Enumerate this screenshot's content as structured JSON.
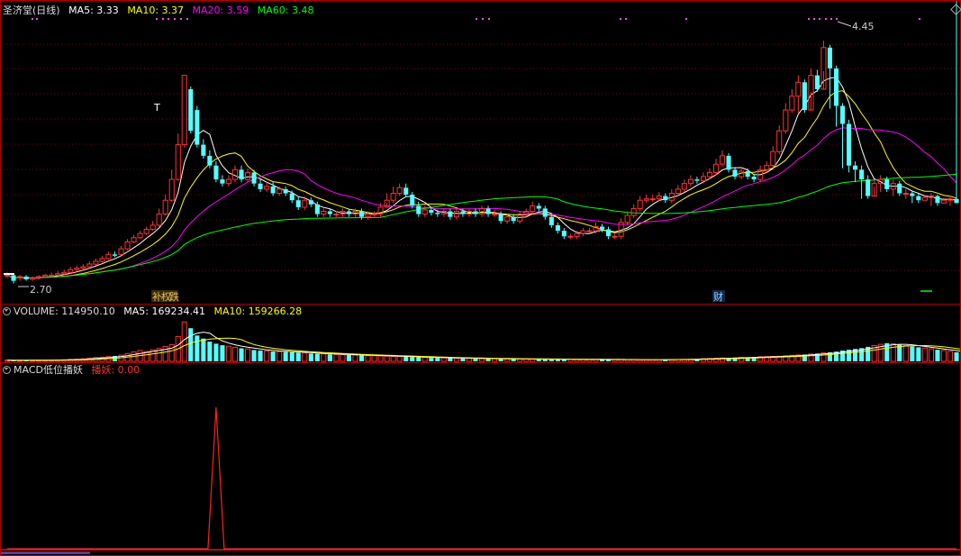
{
  "header": {
    "stock": "圣济堂(日线)",
    "ma5": "MA5: 3.33",
    "ma10": "MA10: 3.37",
    "ma20": "MA20: 3.59",
    "ma60": "MA60: 3.48"
  },
  "volume_header": {
    "title": "VOLUME: 114950.10",
    "ma5": "MA5: 169234.41",
    "ma10": "MA10: 159266.28"
  },
  "macd_header": {
    "title": "MACD低位播妖",
    "value": "播妖: 0.00"
  },
  "annotations": {
    "high": "4.45",
    "low": "2.70",
    "t_mark": "T",
    "event1": "补",
    "event2": "权",
    "event3": "跌",
    "event4": "财"
  },
  "colors": {
    "up": "#ff3232",
    "down": "#54ffff",
    "ma5": "#ffffff",
    "ma10": "#ffff00",
    "ma20": "#ff00ff",
    "ma60": "#00ff00",
    "grid": "#7a0000",
    "frame": "#b00000",
    "macd": "#ff2020"
  },
  "chart_data": [
    {
      "type": "candlestick",
      "title": "圣济堂(日线)",
      "ylim": [
        2.6,
        4.6
      ],
      "x": [
        0,
        1,
        2,
        3,
        4,
        5,
        6,
        7,
        8,
        9,
        10,
        11,
        12,
        13,
        14,
        15,
        16,
        17,
        18,
        19,
        20,
        21,
        22,
        23,
        24,
        25,
        26,
        27,
        28,
        29,
        30,
        31,
        32,
        33,
        34,
        35,
        36,
        37,
        38,
        39,
        40,
        41,
        42,
        43,
        44,
        45,
        46,
        47,
        48,
        49,
        50,
        51,
        52,
        53,
        54,
        55,
        56,
        57,
        58,
        59,
        60,
        61,
        62,
        63,
        64,
        65,
        66,
        67,
        68,
        69,
        70,
        71,
        72,
        73,
        74,
        75,
        76,
        77,
        78,
        79,
        80,
        81,
        82,
        83,
        84,
        85,
        86,
        87,
        88,
        89,
        90,
        91,
        92,
        93,
        94,
        95,
        96,
        97,
        98,
        99,
        100,
        101,
        102,
        103,
        104,
        105,
        106,
        107,
        108,
        109,
        110,
        111,
        112,
        113,
        114,
        115,
        116,
        117,
        118,
        119,
        120,
        121,
        122,
        123,
        124,
        125,
        126,
        127,
        128,
        129,
        130,
        131,
        132,
        133,
        134,
        135,
        136,
        137,
        138,
        139,
        140,
        141,
        142,
        143,
        144,
        145,
        146,
        147,
        148,
        149,
        150,
        151,
        152,
        153,
        154,
        155,
        156,
        157,
        158,
        159,
        160,
        161,
        162,
        163,
        164,
        165,
        166,
        167,
        168,
        169,
        170,
        171,
        172,
        173,
        174,
        175,
        176,
        177
      ],
      "open": [
        2.76,
        2.76,
        2.74,
        2.75,
        2.73,
        2.74,
        2.75,
        2.76,
        2.76,
        2.77,
        2.78,
        2.8,
        2.81,
        2.82,
        2.84,
        2.86,
        2.88,
        2.91,
        2.91,
        2.95,
        3.0,
        3.03,
        3.06,
        3.09,
        3.12,
        3.2,
        3.3,
        3.45,
        3.7,
        4.1,
        3.95,
        3.7,
        3.62,
        3.55,
        3.45,
        3.42,
        3.45,
        3.52,
        3.45,
        3.5,
        3.42,
        3.38,
        3.4,
        3.35,
        3.38,
        3.35,
        3.3,
        3.25,
        3.3,
        3.27,
        3.2,
        3.22,
        3.2,
        3.2,
        3.22,
        3.2,
        3.22,
        3.18,
        3.2,
        3.2,
        3.25,
        3.3,
        3.35,
        3.39,
        3.34,
        3.26,
        3.2,
        3.23,
        3.21,
        3.2,
        3.22,
        3.18,
        3.22,
        3.2,
        3.22,
        3.2,
        3.24,
        3.2,
        3.2,
        3.15,
        3.18,
        3.15,
        3.2,
        3.22,
        3.26,
        3.24,
        3.18,
        3.12,
        3.08,
        3.04,
        3.04,
        3.06,
        3.08,
        3.08,
        3.11,
        3.09,
        3.04,
        3.04,
        3.14,
        3.19,
        3.24,
        3.3,
        3.31,
        3.31,
        3.33,
        3.3,
        3.35,
        3.38,
        3.42,
        3.45,
        3.44,
        3.47,
        3.5,
        3.56,
        3.62,
        3.52,
        3.47,
        3.51,
        3.47,
        3.45,
        3.52,
        3.55,
        3.65,
        3.8,
        3.95,
        4.05,
        4.15,
        3.95,
        4.2,
        4.1,
        4.4,
        4.25,
        3.98,
        3.85,
        3.55,
        3.52,
        3.45,
        3.33,
        3.42,
        3.45,
        3.38,
        3.42,
        3.35,
        3.35,
        3.33,
        3.3,
        3.32,
        3.33,
        3.28,
        3.3,
        3.31
      ],
      "close": [
        2.76,
        2.72,
        2.75,
        2.73,
        2.74,
        2.75,
        2.76,
        2.76,
        2.77,
        2.78,
        2.8,
        2.81,
        2.82,
        2.84,
        2.86,
        2.88,
        2.91,
        2.9,
        2.95,
        3.0,
        3.03,
        3.06,
        3.09,
        3.12,
        3.2,
        3.3,
        3.45,
        3.7,
        4.2,
        3.8,
        3.7,
        3.62,
        3.55,
        3.45,
        3.42,
        3.45,
        3.52,
        3.45,
        3.5,
        3.42,
        3.38,
        3.4,
        3.35,
        3.38,
        3.35,
        3.3,
        3.25,
        3.3,
        3.27,
        3.2,
        3.22,
        3.2,
        3.2,
        3.22,
        3.2,
        3.22,
        3.18,
        3.2,
        3.2,
        3.25,
        3.3,
        3.35,
        3.39,
        3.34,
        3.26,
        3.2,
        3.23,
        3.21,
        3.2,
        3.22,
        3.18,
        3.22,
        3.2,
        3.22,
        3.2,
        3.24,
        3.2,
        3.2,
        3.15,
        3.18,
        3.15,
        3.2,
        3.22,
        3.26,
        3.24,
        3.18,
        3.12,
        3.08,
        3.04,
        3.04,
        3.06,
        3.08,
        3.08,
        3.11,
        3.09,
        3.04,
        3.04,
        3.14,
        3.19,
        3.24,
        3.3,
        3.31,
        3.31,
        3.33,
        3.3,
        3.35,
        3.38,
        3.42,
        3.45,
        3.44,
        3.47,
        3.5,
        3.56,
        3.62,
        3.52,
        3.47,
        3.51,
        3.47,
        3.45,
        3.52,
        3.55,
        3.65,
        3.8,
        3.95,
        4.05,
        4.15,
        3.95,
        4.2,
        4.1,
        4.4,
        4.25,
        3.98,
        3.85,
        3.55,
        3.52,
        3.45,
        3.33,
        3.42,
        3.45,
        3.38,
        3.42,
        3.35,
        3.35,
        3.33,
        3.3,
        3.32,
        3.33,
        3.28,
        3.3,
        3.31,
        3.28
      ],
      "high": [
        2.78,
        2.77,
        2.76,
        2.76,
        2.75,
        2.76,
        2.77,
        2.78,
        2.79,
        2.8,
        2.82,
        2.83,
        2.84,
        2.86,
        2.88,
        2.9,
        2.93,
        2.93,
        2.97,
        3.02,
        3.05,
        3.08,
        3.11,
        3.15,
        3.24,
        3.34,
        3.52,
        3.78,
        4.2,
        4.12,
        3.98,
        3.74,
        3.66,
        3.58,
        3.48,
        3.48,
        3.55,
        3.55,
        3.53,
        3.52,
        3.45,
        3.43,
        3.43,
        3.4,
        3.4,
        3.37,
        3.33,
        3.33,
        3.32,
        3.29,
        3.24,
        3.24,
        3.22,
        3.24,
        3.24,
        3.24,
        3.24,
        3.22,
        3.22,
        3.28,
        3.35,
        3.4,
        3.42,
        3.42,
        3.36,
        3.29,
        3.26,
        3.25,
        3.23,
        3.24,
        3.24,
        3.24,
        3.24,
        3.24,
        3.24,
        3.26,
        3.26,
        3.23,
        3.22,
        3.2,
        3.2,
        3.22,
        3.24,
        3.29,
        3.28,
        3.26,
        3.2,
        3.14,
        3.1,
        3.06,
        3.08,
        3.1,
        3.1,
        3.14,
        3.13,
        3.11,
        3.06,
        3.17,
        3.22,
        3.27,
        3.33,
        3.34,
        3.34,
        3.36,
        3.35,
        3.38,
        3.41,
        3.45,
        3.48,
        3.47,
        3.5,
        3.53,
        3.6,
        3.66,
        3.64,
        3.54,
        3.54,
        3.53,
        3.49,
        3.55,
        3.58,
        3.69,
        3.84,
        4.0,
        4.1,
        4.2,
        4.17,
        4.25,
        4.24,
        4.45,
        4.42,
        4.27,
        4.0,
        3.88,
        3.58,
        3.55,
        3.48,
        3.45,
        3.48,
        3.47,
        3.45,
        3.44,
        3.38,
        3.37,
        3.35,
        3.34,
        3.35,
        3.34,
        3.32,
        3.33,
        3.33
      ],
      "low": [
        2.74,
        2.7,
        2.72,
        2.72,
        2.72,
        2.73,
        2.74,
        2.75,
        2.75,
        2.76,
        2.77,
        2.79,
        2.8,
        2.81,
        2.83,
        2.85,
        2.87,
        2.89,
        2.9,
        2.94,
        2.99,
        3.02,
        3.05,
        3.08,
        3.11,
        3.19,
        3.29,
        3.44,
        3.68,
        3.78,
        3.68,
        3.6,
        3.53,
        3.43,
        3.4,
        3.4,
        3.43,
        3.43,
        3.43,
        3.4,
        3.36,
        3.36,
        3.33,
        3.33,
        3.33,
        3.28,
        3.23,
        3.23,
        3.25,
        3.18,
        3.18,
        3.18,
        3.18,
        3.18,
        3.18,
        3.18,
        3.16,
        3.16,
        3.18,
        3.18,
        3.28,
        3.28,
        3.33,
        3.32,
        3.24,
        3.18,
        3.18,
        3.19,
        3.18,
        3.18,
        3.16,
        3.16,
        3.18,
        3.18,
        3.18,
        3.18,
        3.18,
        3.18,
        3.13,
        3.13,
        3.13,
        3.13,
        3.18,
        3.2,
        3.22,
        3.16,
        3.1,
        3.06,
        3.02,
        3.02,
        3.02,
        3.04,
        3.06,
        3.06,
        3.07,
        3.02,
        3.02,
        3.02,
        3.12,
        3.17,
        3.22,
        3.28,
        3.29,
        3.29,
        3.28,
        3.28,
        3.33,
        3.36,
        3.4,
        3.42,
        3.42,
        3.45,
        3.48,
        3.54,
        3.5,
        3.45,
        3.45,
        3.45,
        3.43,
        3.43,
        3.5,
        3.53,
        3.63,
        3.78,
        3.93,
        3.93,
        3.93,
        4.08,
        4.08,
        4.23,
        3.96,
        3.83,
        3.53,
        3.5,
        3.43,
        3.31,
        3.31,
        3.4,
        3.36,
        3.36,
        3.33,
        3.33,
        3.31,
        3.28,
        3.28,
        3.3,
        3.26,
        3.26,
        3.28,
        3.26
      ]
    },
    {
      "type": "bar",
      "title": "VOLUME",
      "values": [
        60,
        55,
        50,
        58,
        52,
        60,
        64,
        62,
        70,
        80,
        95,
        110,
        120,
        160,
        185,
        200,
        230,
        260,
        300,
        380,
        450,
        520,
        480,
        560,
        620,
        720,
        800,
        1200,
        1900,
        1600,
        1250,
        1100,
        950,
        850,
        780,
        730,
        680,
        630,
        600,
        550,
        520,
        500,
        480,
        470,
        460,
        440,
        420,
        400,
        380,
        370,
        360,
        340,
        330,
        320,
        310,
        300,
        290,
        280,
        270,
        260,
        250,
        240,
        230,
        220,
        210,
        200,
        190,
        180,
        170,
        165,
        160,
        155,
        150,
        145,
        140,
        135,
        130,
        125,
        120,
        118,
        116,
        114,
        112,
        110,
        108,
        106,
        104,
        102,
        100,
        100,
        98,
        96,
        95,
        94,
        92,
        90,
        88,
        86,
        84,
        82,
        80,
        80,
        82,
        84,
        86,
        90,
        95,
        100,
        110,
        120,
        130,
        140,
        150,
        160,
        170,
        180,
        190,
        200,
        210,
        220,
        230,
        240,
        250,
        270,
        290,
        310,
        330,
        350,
        380,
        410,
        440,
        470,
        520,
        560,
        600,
        640,
        700,
        760,
        820,
        880,
        850,
        800,
        760,
        720,
        680,
        640,
        600,
        560,
        520,
        480,
        440,
        400,
        370,
        340,
        320,
        300,
        290,
        280,
        270,
        260,
        250,
        240,
        230,
        220,
        210,
        200,
        190,
        180,
        170,
        160,
        150,
        140,
        130,
        120,
        115
      ],
      "ylim": [
        0,
        2000
      ]
    },
    {
      "type": "line",
      "title": "MACD低位播妖",
      "series": [
        {
          "name": "播妖",
          "values": [
            0,
            0,
            0,
            0,
            0,
            0,
            0,
            0,
            0,
            0,
            0,
            0,
            0,
            0,
            0,
            0,
            0,
            0,
            0,
            0,
            0,
            0,
            0,
            0,
            0,
            0,
            0,
            0,
            0,
            0,
            0,
            0,
            0,
            0,
            0,
            0,
            0,
            0,
            0,
            0,
            0,
            0,
            0,
            0,
            0,
            0,
            0,
            0,
            0,
            0,
            0,
            0,
            0,
            0,
            0,
            0,
            0,
            0,
            0,
            0,
            0,
            0,
            0,
            0,
            0,
            0,
            0,
            0,
            0,
            0,
            0,
            0,
            0,
            0,
            0,
            0,
            0,
            0,
            0,
            0,
            0,
            0,
            0,
            0,
            0,
            0,
            0,
            0,
            0,
            0,
            0,
            0,
            0,
            0,
            0,
            0,
            0,
            0,
            0,
            0,
            0,
            0,
            0,
            0,
            0,
            0,
            0,
            0,
            0,
            0,
            0,
            0,
            0,
            0,
            0,
            0,
            0,
            0,
            0,
            0,
            0,
            0,
            0,
            0,
            0,
            0,
            0,
            0,
            0,
            0,
            0,
            0,
            0,
            0,
            0,
            0,
            0,
            0,
            0,
            0,
            0,
            0,
            0,
            0,
            0,
            0,
            0,
            0,
            0,
            0,
            0,
            0,
            0,
            0,
            0,
            0,
            0,
            0,
            0,
            0,
            0,
            0,
            0,
            0,
            0,
            0,
            0,
            0,
            0,
            0,
            0,
            0,
            0,
            0,
            0,
            0,
            0,
            0
          ]
        }
      ],
      "spike_index": 33,
      "spike_value": 1.0,
      "ylim": [
        0,
        1
      ]
    }
  ]
}
